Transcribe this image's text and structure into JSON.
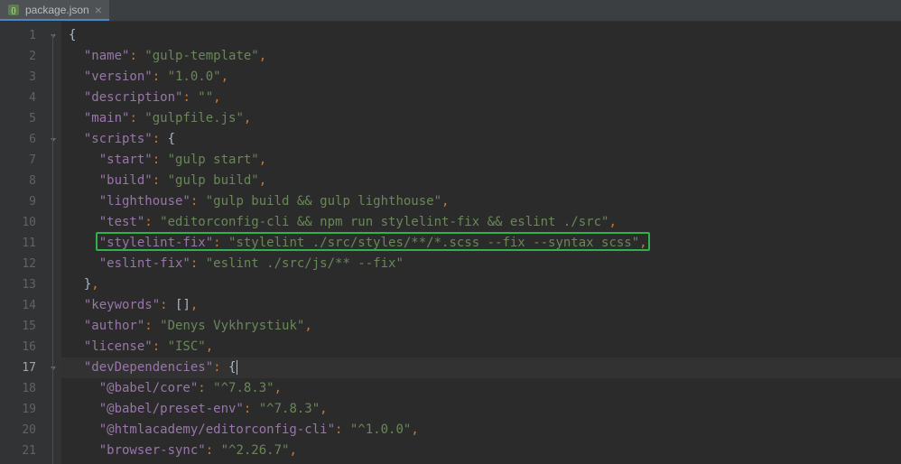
{
  "tab": {
    "filename": "package.json"
  },
  "editor": {
    "currentLine": 17,
    "highlightedLine": 11,
    "runnableLines": [
      7,
      8,
      9,
      10,
      11,
      12
    ],
    "foldLines": [
      1,
      6,
      17
    ],
    "lines": [
      {
        "num": 1,
        "indent": 0,
        "tokens": [
          {
            "t": "br",
            "v": "{"
          }
        ]
      },
      {
        "num": 2,
        "indent": 1,
        "tokens": [
          {
            "t": "k",
            "v": "\"name\""
          },
          {
            "t": "p",
            "v": ": "
          },
          {
            "t": "s",
            "v": "\"gulp-template\""
          },
          {
            "t": "p",
            "v": ","
          }
        ]
      },
      {
        "num": 3,
        "indent": 1,
        "tokens": [
          {
            "t": "k",
            "v": "\"version\""
          },
          {
            "t": "p",
            "v": ": "
          },
          {
            "t": "s",
            "v": "\"1.0.0\""
          },
          {
            "t": "p",
            "v": ","
          }
        ]
      },
      {
        "num": 4,
        "indent": 1,
        "tokens": [
          {
            "t": "k",
            "v": "\"description\""
          },
          {
            "t": "p",
            "v": ": "
          },
          {
            "t": "s",
            "v": "\"\""
          },
          {
            "t": "p",
            "v": ","
          }
        ]
      },
      {
        "num": 5,
        "indent": 1,
        "tokens": [
          {
            "t": "k",
            "v": "\"main\""
          },
          {
            "t": "p",
            "v": ": "
          },
          {
            "t": "s",
            "v": "\"gulpfile.js\""
          },
          {
            "t": "p",
            "v": ","
          }
        ]
      },
      {
        "num": 6,
        "indent": 1,
        "tokens": [
          {
            "t": "k",
            "v": "\"scripts\""
          },
          {
            "t": "p",
            "v": ": "
          },
          {
            "t": "br",
            "v": "{"
          }
        ]
      },
      {
        "num": 7,
        "indent": 2,
        "tokens": [
          {
            "t": "k",
            "v": "\"start\""
          },
          {
            "t": "p",
            "v": ": "
          },
          {
            "t": "s",
            "v": "\"gulp start\""
          },
          {
            "t": "p",
            "v": ","
          }
        ]
      },
      {
        "num": 8,
        "indent": 2,
        "tokens": [
          {
            "t": "k",
            "v": "\"build\""
          },
          {
            "t": "p",
            "v": ": "
          },
          {
            "t": "s",
            "v": "\"gulp build\""
          },
          {
            "t": "p",
            "v": ","
          }
        ]
      },
      {
        "num": 9,
        "indent": 2,
        "tokens": [
          {
            "t": "k",
            "v": "\"lighthouse\""
          },
          {
            "t": "p",
            "v": ": "
          },
          {
            "t": "s",
            "v": "\"gulp build && gulp lighthouse\""
          },
          {
            "t": "p",
            "v": ","
          }
        ]
      },
      {
        "num": 10,
        "indent": 2,
        "tokens": [
          {
            "t": "k",
            "v": "\"test\""
          },
          {
            "t": "p",
            "v": ": "
          },
          {
            "t": "s",
            "v": "\"editorconfig-cli && npm run stylelint-fix && eslint ./src\""
          },
          {
            "t": "p",
            "v": ","
          }
        ]
      },
      {
        "num": 11,
        "indent": 2,
        "tokens": [
          {
            "t": "k",
            "v": "\"stylelint-fix\""
          },
          {
            "t": "p",
            "v": ": "
          },
          {
            "t": "s",
            "v": "\"stylelint ./src/styles/**/*.scss --fix --syntax scss\""
          },
          {
            "t": "p",
            "v": ","
          }
        ]
      },
      {
        "num": 12,
        "indent": 2,
        "tokens": [
          {
            "t": "k",
            "v": "\"eslint-fix\""
          },
          {
            "t": "p",
            "v": ": "
          },
          {
            "t": "s",
            "v": "\"eslint ./src/js/** --fix\""
          }
        ]
      },
      {
        "num": 13,
        "indent": 1,
        "tokens": [
          {
            "t": "br",
            "v": "}"
          },
          {
            "t": "p",
            "v": ","
          }
        ]
      },
      {
        "num": 14,
        "indent": 1,
        "tokens": [
          {
            "t": "k",
            "v": "\"keywords\""
          },
          {
            "t": "p",
            "v": ": "
          },
          {
            "t": "br",
            "v": "[]"
          },
          {
            "t": "p",
            "v": ","
          }
        ]
      },
      {
        "num": 15,
        "indent": 1,
        "tokens": [
          {
            "t": "k",
            "v": "\"author\""
          },
          {
            "t": "p",
            "v": ": "
          },
          {
            "t": "s",
            "v": "\"Denys Vykhrystiuk\""
          },
          {
            "t": "p",
            "v": ","
          }
        ]
      },
      {
        "num": 16,
        "indent": 1,
        "tokens": [
          {
            "t": "k",
            "v": "\"license\""
          },
          {
            "t": "p",
            "v": ": "
          },
          {
            "t": "s",
            "v": "\"ISC\""
          },
          {
            "t": "p",
            "v": ","
          }
        ]
      },
      {
        "num": 17,
        "indent": 1,
        "tokens": [
          {
            "t": "k",
            "v": "\"devDependencies\""
          },
          {
            "t": "p",
            "v": ": "
          },
          {
            "t": "br",
            "v": "{"
          }
        ],
        "caretAfter": true
      },
      {
        "num": 18,
        "indent": 2,
        "tokens": [
          {
            "t": "k",
            "v": "\"@babel/core\""
          },
          {
            "t": "p",
            "v": ": "
          },
          {
            "t": "s",
            "v": "\"^7.8.3\""
          },
          {
            "t": "p",
            "v": ","
          }
        ]
      },
      {
        "num": 19,
        "indent": 2,
        "tokens": [
          {
            "t": "k",
            "v": "\"@babel/preset-env\""
          },
          {
            "t": "p",
            "v": ": "
          },
          {
            "t": "s",
            "v": "\"^7.8.3\""
          },
          {
            "t": "p",
            "v": ","
          }
        ]
      },
      {
        "num": 20,
        "indent": 2,
        "tokens": [
          {
            "t": "k",
            "v": "\"@htmlacademy/editorconfig-cli\""
          },
          {
            "t": "p",
            "v": ": "
          },
          {
            "t": "s",
            "v": "\"^1.0.0\""
          },
          {
            "t": "p",
            "v": ","
          }
        ]
      },
      {
        "num": 21,
        "indent": 2,
        "tokens": [
          {
            "t": "k",
            "v": "\"browser-sync\""
          },
          {
            "t": "p",
            "v": ": "
          },
          {
            "t": "s",
            "v": "\"^2.26.7\""
          },
          {
            "t": "p",
            "v": ","
          }
        ]
      }
    ]
  }
}
